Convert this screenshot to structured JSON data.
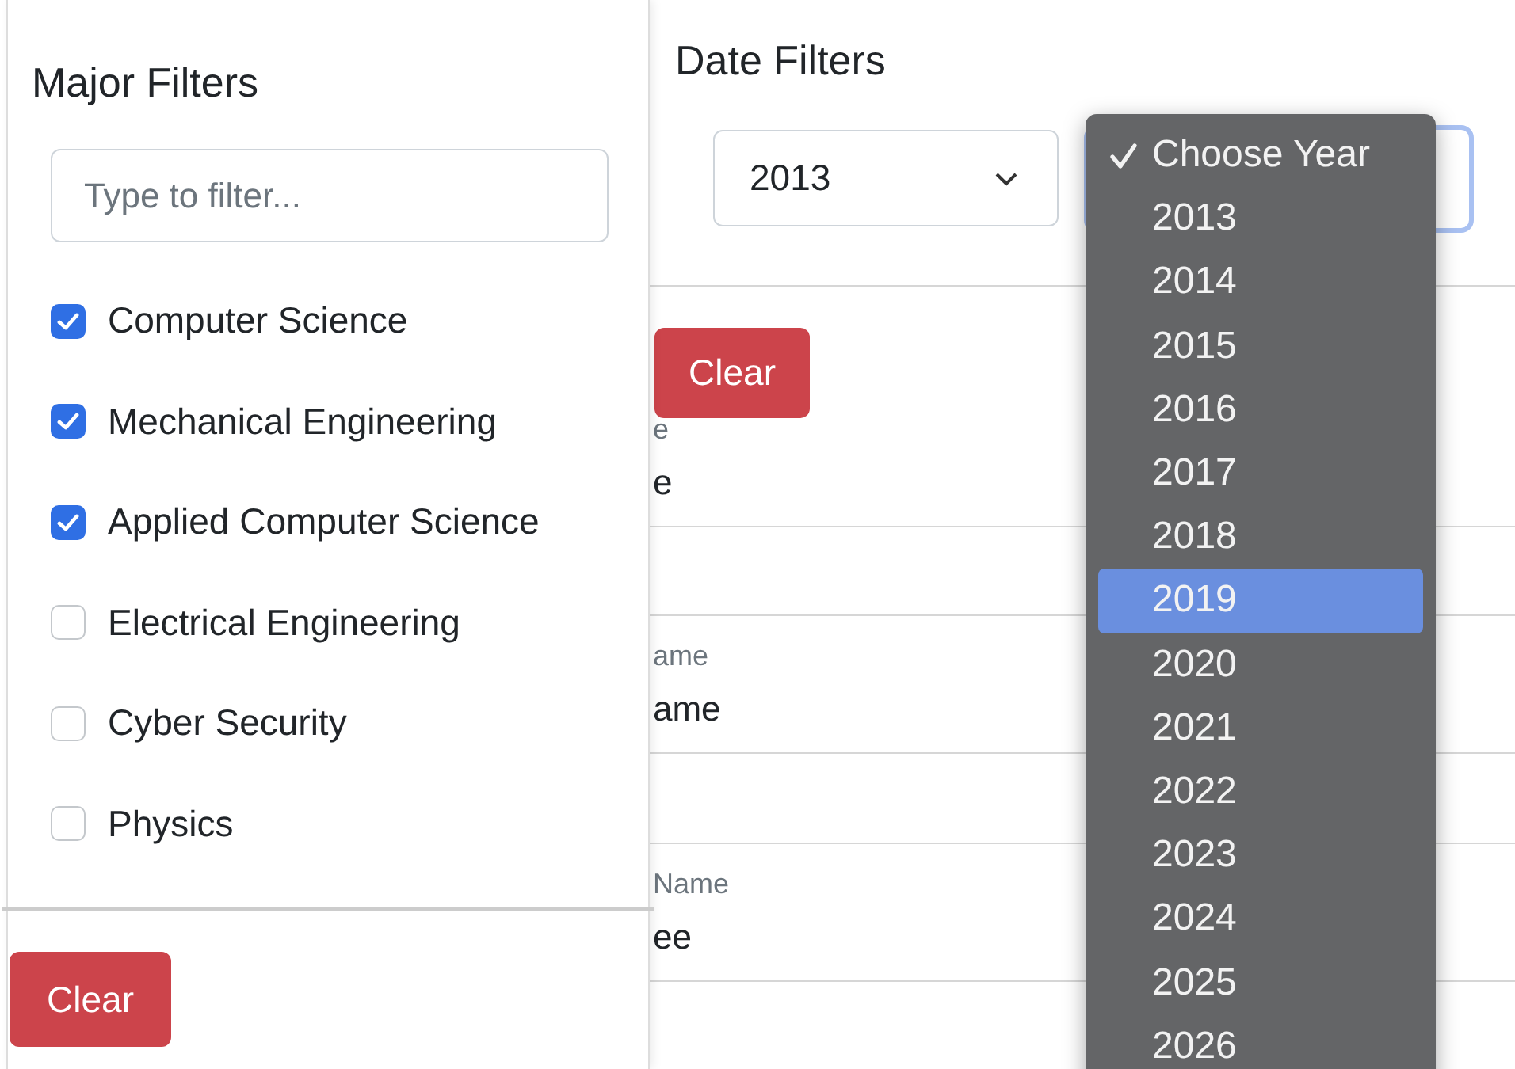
{
  "major_filters": {
    "title": "Major Filters",
    "search": {
      "placeholder": "Type to filter..."
    },
    "options": [
      {
        "label": "Computer Science",
        "checked": true
      },
      {
        "label": "Mechanical Engineering",
        "checked": true
      },
      {
        "label": "Applied Computer Science",
        "checked": true
      },
      {
        "label": "Electrical Engineering",
        "checked": false
      },
      {
        "label": "Cyber Security",
        "checked": false
      },
      {
        "label": "Physics",
        "checked": false
      }
    ],
    "clear_button": "Clear"
  },
  "date_filters": {
    "title": "Date Filters",
    "year_select": {
      "value": "2013"
    },
    "clear_button": "Clear"
  },
  "records": [
    {
      "label": "e",
      "value": "e"
    },
    {
      "label": "ame",
      "value": "ame"
    },
    {
      "label": "Name",
      "value": "ee"
    }
  ],
  "year_menu": {
    "items": [
      {
        "label": "Choose Year",
        "checked": true,
        "selected": false
      },
      {
        "label": "2013",
        "checked": false,
        "selected": false
      },
      {
        "label": "2014",
        "checked": false,
        "selected": false
      },
      {
        "label": "2015",
        "checked": false,
        "selected": false
      },
      {
        "label": "2016",
        "checked": false,
        "selected": false
      },
      {
        "label": "2017",
        "checked": false,
        "selected": false
      },
      {
        "label": "2018",
        "checked": false,
        "selected": false
      },
      {
        "label": "2019",
        "checked": false,
        "selected": true
      },
      {
        "label": "2020",
        "checked": false,
        "selected": false
      },
      {
        "label": "2021",
        "checked": false,
        "selected": false
      },
      {
        "label": "2022",
        "checked": false,
        "selected": false
      },
      {
        "label": "2023",
        "checked": false,
        "selected": false
      },
      {
        "label": "2024",
        "checked": false,
        "selected": false
      },
      {
        "label": "2025",
        "checked": false,
        "selected": false
      },
      {
        "label": "2026",
        "checked": false,
        "selected": false
      }
    ]
  }
}
